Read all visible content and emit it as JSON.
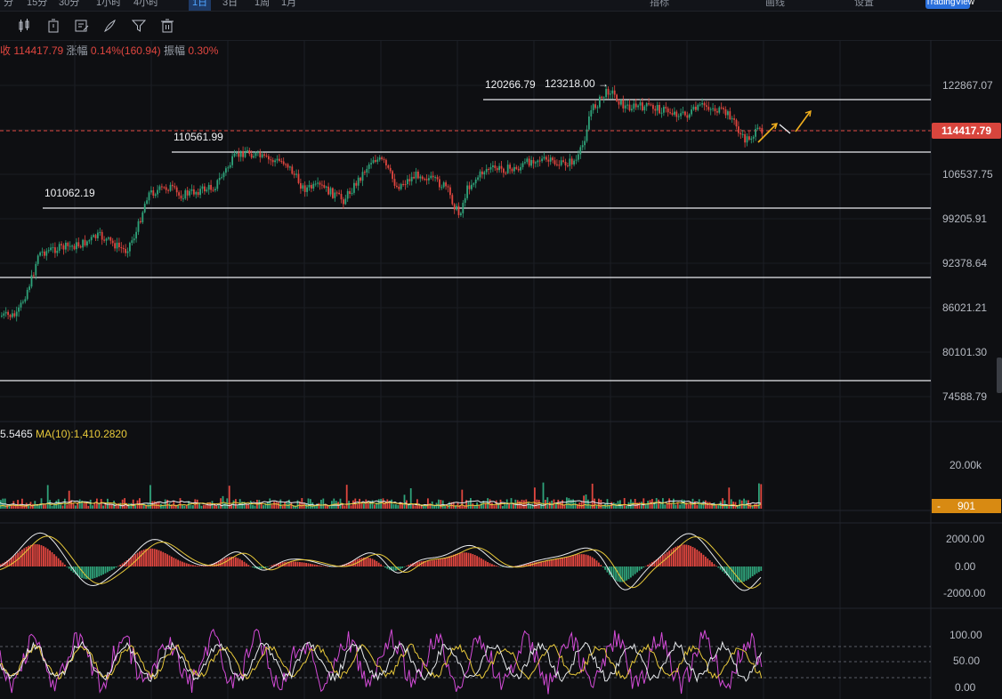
{
  "topbar": {
    "timeframes": [
      "分",
      "15分",
      "30分",
      "1小时",
      "4小时",
      "1日",
      "3日",
      "1周",
      "1月"
    ],
    "active_index": 5,
    "right_items": [
      "指标",
      "画线",
      "设置"
    ],
    "pill_label": "TradingView"
  },
  "toolbar": {
    "icons": [
      "candle-type-icon",
      "timer-icon",
      "draw-icon",
      "brush-icon",
      "filter-icon",
      "trash-icon"
    ]
  },
  "info": {
    "prefix": "收",
    "close": "114417.79",
    "change_label": "涨幅",
    "change_value": "0.14%(160.94)",
    "amp_label": "振幅",
    "amp_value": "0.30%"
  },
  "price_axis": [
    "122867.07",
    "106537.75",
    "99205.91",
    "92378.64",
    "86021.21",
    "80101.30",
    "74588.79"
  ],
  "current_price": "114417.79",
  "levels": [
    {
      "label": "120266.79"
    },
    {
      "label": "110561.99"
    },
    {
      "label": "101062.19"
    }
  ],
  "ath_label": "123218.00 →",
  "volume": {
    "ma5_text": "5.5465",
    "ma10_text": "MA(10):1,410.2820",
    "axis_top": "20.00k",
    "current_tag": "901"
  },
  "macd_axis": [
    "2000.00",
    "0.00",
    "-2000.00"
  ],
  "kdj_axis": [
    "100.00",
    "50.00",
    "0.00"
  ],
  "colors": {
    "up": "#2fa37a",
    "down": "#e0463f",
    "ma_white": "#e9ebee",
    "ma_yellow": "#e8c93a",
    "kdj_magenta": "#d44bd8",
    "arrow": "#f2b01e"
  }
}
